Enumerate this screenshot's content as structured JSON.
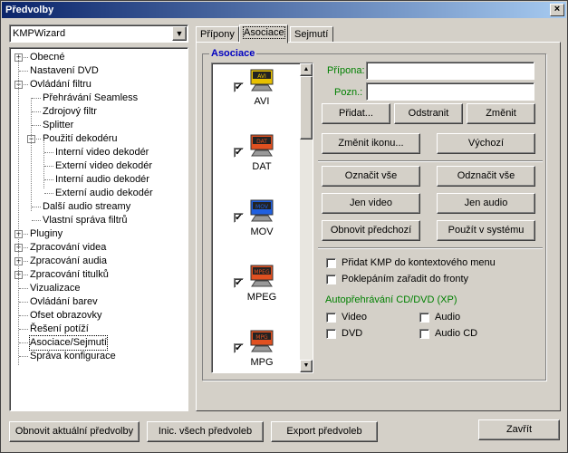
{
  "window": {
    "title": "Předvolby",
    "close_glyph": "×"
  },
  "profile": {
    "value": "KMPWizard"
  },
  "tree": [
    {
      "label": "Obecné",
      "expander": "+"
    },
    {
      "label": "Nastavení DVD"
    },
    {
      "label": "Ovládání filtru",
      "expander": "−"
    },
    {
      "label": "Přehrávání Seamless"
    },
    {
      "label": "Zdrojový filtr"
    },
    {
      "label": "Splitter"
    },
    {
      "label": "Použití dekodéru",
      "expander": "−"
    },
    {
      "label": "Interní video dekodér"
    },
    {
      "label": "Externí video dekodér"
    },
    {
      "label": "Interní audio dekodér"
    },
    {
      "label": "Externí audio dekodér"
    },
    {
      "label": "Další audio streamy"
    },
    {
      "label": "Vlastní správa filtrů"
    },
    {
      "label": "Pluginy",
      "expander": "+"
    },
    {
      "label": "Zpracování videa",
      "expander": "+"
    },
    {
      "label": "Zpracování audia",
      "expander": "+"
    },
    {
      "label": "Zpracování titulků",
      "expander": "+"
    },
    {
      "label": "Vizualizace"
    },
    {
      "label": "Ovládání barev"
    },
    {
      "label": "Ofset obrazovky"
    },
    {
      "label": "Řešení potíží"
    },
    {
      "label": "Asociace/Sejmutí",
      "selected": true
    },
    {
      "label": "Správa konfigurace"
    }
  ],
  "tabs": [
    {
      "label": "Přípony"
    },
    {
      "label": "Asociace",
      "active": true
    },
    {
      "label": "Sejmutí"
    }
  ],
  "association": {
    "group_title": "Asociace",
    "files": [
      {
        "name": "AVI",
        "badge": "AVI",
        "checked": true,
        "color": "#e8c000"
      },
      {
        "name": "DAT",
        "badge": "DAT",
        "checked": true,
        "color": "#e05020"
      },
      {
        "name": "MOV",
        "badge": "MOV",
        "checked": true,
        "color": "#2060e0"
      },
      {
        "name": "MPEG",
        "badge": "MPEG",
        "checked": true,
        "color": "#e05020"
      },
      {
        "name": "MPG",
        "badge": "MPG",
        "checked": true,
        "color": "#e05020"
      }
    ],
    "extension_label": "Přípona:",
    "extension_value": "",
    "description_label": "Pozn.:",
    "description_value": "",
    "buttons": {
      "add": "Přidat...",
      "remove": "Odstranit",
      "change": "Změnit",
      "change_icon": "Změnit ikonu...",
      "default": "Výchozí",
      "select_all": "Označit vše",
      "deselect_all": "Odznačit vše",
      "only_video": "Jen video",
      "only_audio": "Jen audio",
      "restore_previous": "Obnovit předchozí",
      "apply_system": "Použít v systému"
    },
    "options": {
      "context_menu": "Přidat KMP do kontextového menu",
      "enqueue": "Poklepáním zařadit do fronty"
    },
    "autoplay": {
      "title": "Autopřehrávání CD/DVD (XP)",
      "video": "Video",
      "audio": "Audio",
      "dvd": "DVD",
      "audio_cd": "Audio CD"
    }
  },
  "footer": {
    "reset_current": "Obnovit aktuální předvolby",
    "init_all": "Inic. všech předvoleb",
    "export": "Export předvoleb",
    "close": "Zavřít"
  },
  "colors": {
    "accent_green": "#008000",
    "group_title": "#0000c0",
    "titlebar": "#0a246a"
  }
}
